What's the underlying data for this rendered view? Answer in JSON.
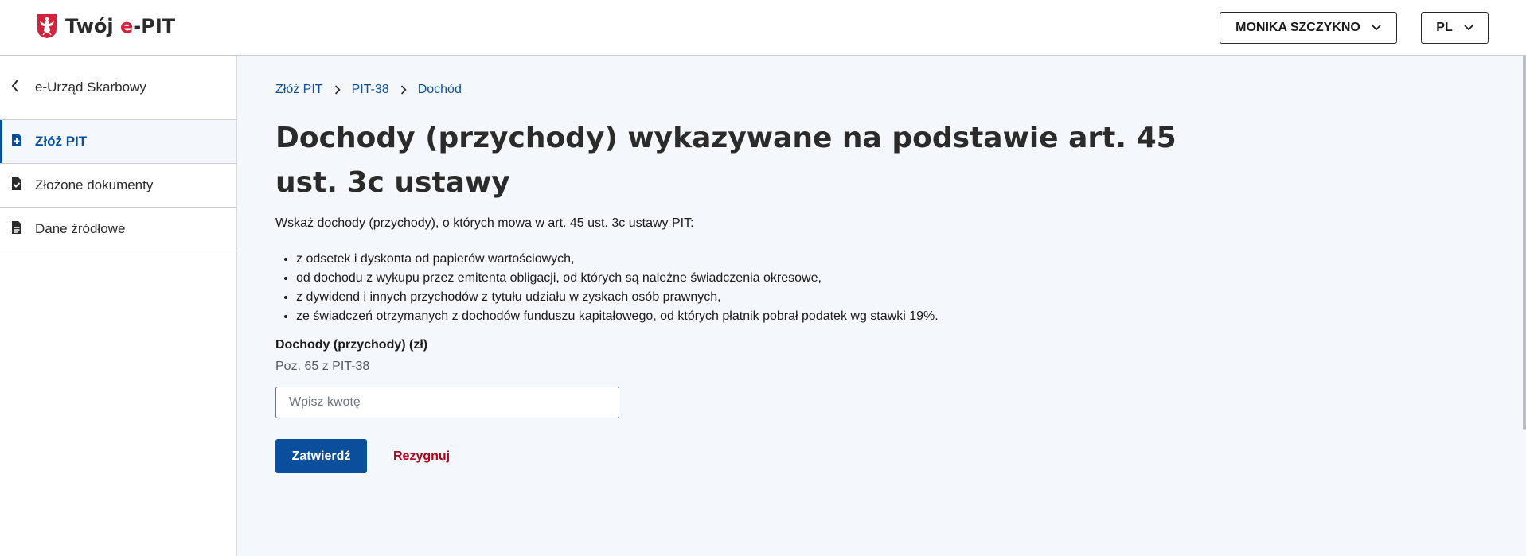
{
  "header": {
    "logo_text_prefix": "Twój ",
    "logo_text_accent": "e",
    "logo_text_suffix": "-PIT",
    "user_button_label": "MONIKA SZCZYKNO",
    "lang_button_label": "PL"
  },
  "sidebar": {
    "back_label": "e-Urząd Skarbowy",
    "items": [
      {
        "label": "Złóż PIT",
        "icon": "document-add-icon",
        "active": true
      },
      {
        "label": "Złożone dokumenty",
        "icon": "document-check-icon",
        "active": false
      },
      {
        "label": "Dane źródłowe",
        "icon": "document-text-icon",
        "active": false
      }
    ]
  },
  "breadcrumb": [
    "Złóż PIT",
    "PIT-38",
    "Dochód"
  ],
  "main": {
    "title": "Dochody (przychody) wykazywane na podstawie art. 45 ust. 3c ustawy",
    "intro": "Wskaż dochody (przychody), o których mowa w art. 45 ust. 3c ustawy PIT:",
    "bullets": [
      "z odsetek i dyskonta od papierów wartościowych,",
      "od dochodu z wykupu przez emitenta obligacji, od których są należne świadczenia okresowe,",
      "z dywidend i innych przychodów z tytułu udziału w zyskach osób prawnych,",
      "ze świadczeń otrzymanych z dochodów funduszu kapitałowego, od których płatnik pobrał podatek wg stawki 19%."
    ],
    "field_label": "Dochody (przychody) (zł)",
    "field_hint": "Poz. 65 z PIT-38",
    "input_value": "",
    "input_placeholder": "Wpisz kwotę",
    "submit_label": "Zatwierdź",
    "cancel_label": "Rezygnuj"
  },
  "colors": {
    "primary": "#0b4e9c",
    "danger": "#b3001b",
    "logo_accent": "#d4213d",
    "page_bg": "#f4f7fb"
  }
}
